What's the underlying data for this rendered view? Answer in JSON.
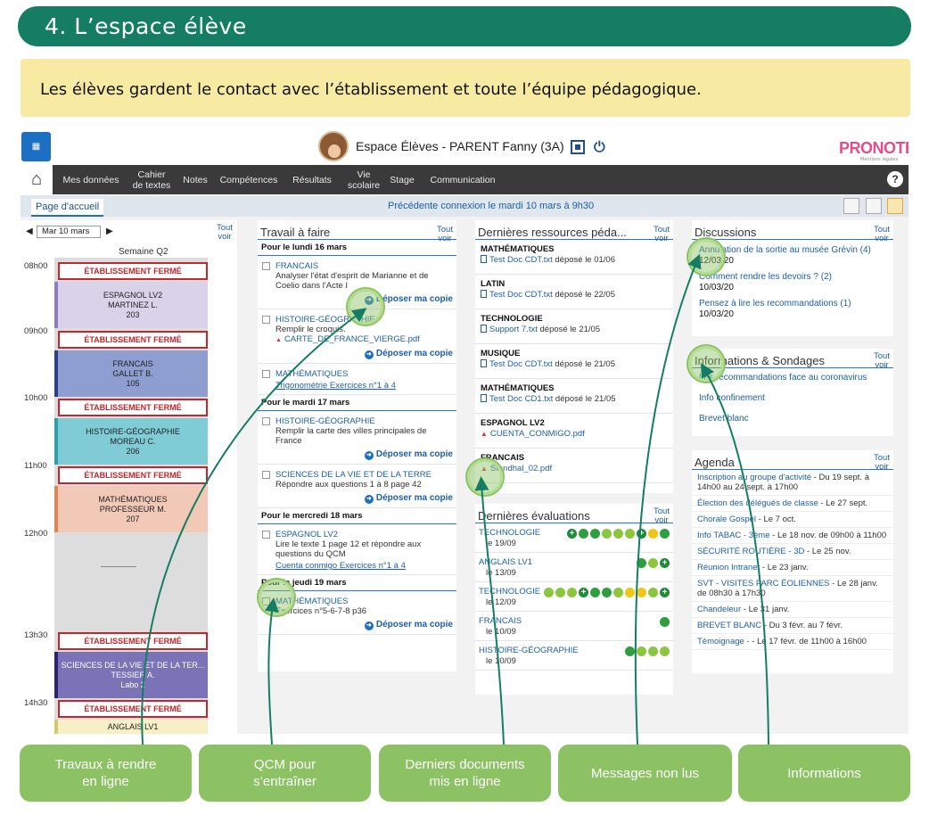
{
  "banner": {
    "title": "4. L’espace élève"
  },
  "intro": {
    "text": "Les élèves gardent le contact avec l’établissement et toute l’équipe pédagogique."
  },
  "app": {
    "header": {
      "title": "Espace Élèves - PARENT Fanny (3A)",
      "brand": "PRONOTE",
      "brand_sub": "Mentions légales"
    },
    "nav": {
      "items": [
        "Mes données",
        "Cahier\nde textes",
        "Notes",
        "Compétences",
        "Résultats",
        "Vie\nscolaire",
        "Stage",
        "Communication"
      ],
      "help": "?"
    },
    "subbar": {
      "tab": "Page d'accueil",
      "connection": "Précédente connexion le mardi 10 mars à 9h30"
    },
    "calendar": {
      "date": "Mar 10 mars",
      "tout_voir": "Tout voir",
      "week": "Semaine Q2",
      "hours": [
        "08h00",
        "09h00",
        "10h00",
        "11h00",
        "12h00",
        "13h30",
        "14h30"
      ],
      "closed_label": "ÉTABLISSEMENT FERMÉ",
      "events": [
        {
          "subject": "ESPAGNOL LV2",
          "teacher": "MARTINEZ L.",
          "room": "203",
          "color": "#d9d2e9",
          "bar": "#8e7cc3"
        },
        {
          "subject": "FRANCAIS",
          "teacher": "GALLET B.",
          "room": "105",
          "color": "#8e9ed0",
          "bar": "#2c3e8f"
        },
        {
          "subject": "HISTOIRE-GÉOGRAPHIE",
          "teacher": "MOREAU C.",
          "room": "206",
          "color": "#7fcbd6",
          "bar": "#2aa0b3"
        },
        {
          "subject": "MATHÉMATIQUES",
          "teacher": "PROFESSEUR M.",
          "room": "207",
          "color": "#f2c8b6",
          "bar": "#e8824f"
        },
        {
          "subject": "SCIENCES DE LA VIE ET DE LA TER...",
          "teacher": "TESSIER A.",
          "room": "Labo 2",
          "color": "#7b73b8",
          "bar": "#2c2373"
        },
        {
          "subject": "ANGLAIS LV1",
          "teacher": "",
          "room": "",
          "color": "#f7efc6",
          "bar": "#d9c56a"
        }
      ]
    },
    "travail": {
      "title": "Travail à faire",
      "tout_voir": "Tout voir",
      "depot": "Déposer ma copie",
      "days": [
        {
          "label": "Pour le lundi 16 mars",
          "tasks": [
            {
              "subject": "FRANCAIS",
              "text": "Analyser l'état d'esprit de Marianne et de Coelio dans l'Acte I",
              "file": "",
              "depot": true
            },
            {
              "subject": "HISTOIRE-GÉOGRAPHIE",
              "text": "Remplir le croquis.",
              "file": "CARTE_DE_FRANCE_VIERGE.pdf",
              "depot": true
            },
            {
              "subject": "MATHÉMATIQUES",
              "text": "",
              "link": "Trigonométrie Exercices n°1 à 4",
              "depot": false
            }
          ]
        },
        {
          "label": "Pour le mardi 17 mars",
          "tasks": [
            {
              "subject": "HISTOIRE-GÉOGRAPHIE",
              "text": "Remplir la carte des villes principales de France",
              "file": "",
              "depot": true
            },
            {
              "subject": "SCIENCES DE LA VIE ET DE LA TERRE",
              "text": "Répondre aux questions 1 à 8 page 42",
              "file": "",
              "depot": true
            }
          ]
        },
        {
          "label": "Pour le mercredi 18 mars",
          "tasks": [
            {
              "subject": "ESPAGNOL LV2",
              "text": "Lire le texte 1 page 12 et répondre aux questions du QCM",
              "link": "Cuenta conmigo Exercices n°1 à 4",
              "depot": false
            }
          ]
        },
        {
          "label": "Pour le jeudi 19 mars",
          "tasks": [
            {
              "subject": "MATHÉMATIQUES",
              "text": "Exercices n°5-6-7-8 p36",
              "file": "",
              "depot": true
            }
          ]
        }
      ]
    },
    "ressources": {
      "title": "Dernières ressources péda...",
      "tout_voir": "Tout voir",
      "items": [
        {
          "subject": "MATHÉMATIQUES",
          "file": "Test Doc CDT.txt",
          "date": "déposé le 01/06",
          "type": "txt"
        },
        {
          "subject": "LATIN",
          "file": "Test Doc CDT.txt",
          "date": "déposé le 22/05",
          "type": "txt"
        },
        {
          "subject": "TECHNOLOGIE",
          "file": "Support 7.txt",
          "date": "déposé le 21/05",
          "type": "txt"
        },
        {
          "subject": "MUSIQUE",
          "file": "Test Doc CDT.txt",
          "date": "déposé le 21/05",
          "type": "txt"
        },
        {
          "subject": "MATHÉMATIQUES",
          "file": "Test Doc CD1.txt",
          "date": "déposé le 21/05",
          "type": "txt"
        },
        {
          "subject": "ESPAGNOL LV2",
          "file": "CUENTA_CONMIGO.pdf",
          "date": "",
          "type": "pdf"
        },
        {
          "subject": "FRANCAIS",
          "file": "Stendhal_02.pdf",
          "date": "",
          "type": "pdf"
        }
      ]
    },
    "evaluations": {
      "title": "Dernières évaluations",
      "tout_voir": "Tout voir",
      "colors": {
        "g": "#2e9e3e",
        "l": "#8cc63f",
        "y": "#f2c617",
        "p": "#1f8a3a"
      },
      "items": [
        {
          "subject": "TECHNOLOGIE",
          "date": "le 19/09",
          "dots": [
            "p",
            "g",
            "g",
            "l",
            "l",
            "l",
            "p",
            "y",
            "g"
          ]
        },
        {
          "subject": "ANGLAIS LV1",
          "date": "le 13/09",
          "dots": [
            "g",
            "l",
            "p"
          ]
        },
        {
          "subject": "TECHNOLOGIE",
          "date": "le 12/09",
          "dots": [
            "l",
            "l",
            "l",
            "p",
            "g",
            "g",
            "l",
            "y",
            "y",
            "l",
            "p"
          ]
        },
        {
          "subject": "FRANCAIS",
          "date": "le 10/09",
          "dots": [
            "g"
          ]
        },
        {
          "subject": "HISTOIRE-GÉOGRAPHIE",
          "date": "le 10/09",
          "dots": [
            "g",
            "l",
            "l",
            "l"
          ]
        }
      ]
    },
    "discussions": {
      "title": "Discussions",
      "tout_voir": "Tout voir",
      "items": [
        {
          "title": "Annulation de la sortie au musée Grévin (4)",
          "date": "12/03/20"
        },
        {
          "title": "Comment rendre les devoirs ? (2)",
          "date": "10/03/20"
        },
        {
          "title": "Pensez à lire les recommandations (1)",
          "date": "10/03/20"
        }
      ]
    },
    "informations": {
      "title": "Informations & Sondages",
      "tout_voir": "Tout voir",
      "items": [
        "Les recommandations face au coronavirus",
        "Info confinement",
        "Brevet blanc"
      ]
    },
    "agenda": {
      "title": "Agenda",
      "tout_voir": "Tout voir",
      "items": [
        {
          "link": "Inscription au groupe d'activité",
          "rest": " - Du 19 sept. à 14h00 au 24 sept. à 17h00"
        },
        {
          "link": "Élection des délégués de classe",
          "rest": " - Le 27 sept."
        },
        {
          "link": "Chorale Gospel",
          "rest": " - Le 7 oct."
        },
        {
          "link": "Info TABAC - 3ème",
          "rest": " - Le 18 nov. de 09h00 à 11h00"
        },
        {
          "link": "SÉCURITÉ ROUTIÈRE - 3D",
          "rest": " - Le 25 nov."
        },
        {
          "link": "Réunion Intranet",
          "rest": " - Le 23 janv."
        },
        {
          "link": "SVT - VISITES PARC ÉOLIENNES",
          "rest": " - Le 28 janv. de 08h30 à 17h30"
        },
        {
          "link": "Chandeleur",
          "rest": " - Le 31 janv."
        },
        {
          "link": "BREVET BLANC",
          "rest": " - Du 3 févr. au 7 févr."
        },
        {
          "link": "Témoignage -",
          "rest": " - Le 17 févr. de 11h00 à 16h00"
        }
      ]
    }
  },
  "callouts": [
    "Travaux à rendre\nen ligne",
    "QCM pour\ns’entraîner",
    "Derniers documents\nmis en ligne",
    "Messages non lus",
    "Informations"
  ],
  "colors": {
    "banner": "#157e62",
    "intro_bg": "#f7eaa2",
    "callout": "#8cc263",
    "nav": "#3a3a3a",
    "link": "#1d5fa7"
  }
}
